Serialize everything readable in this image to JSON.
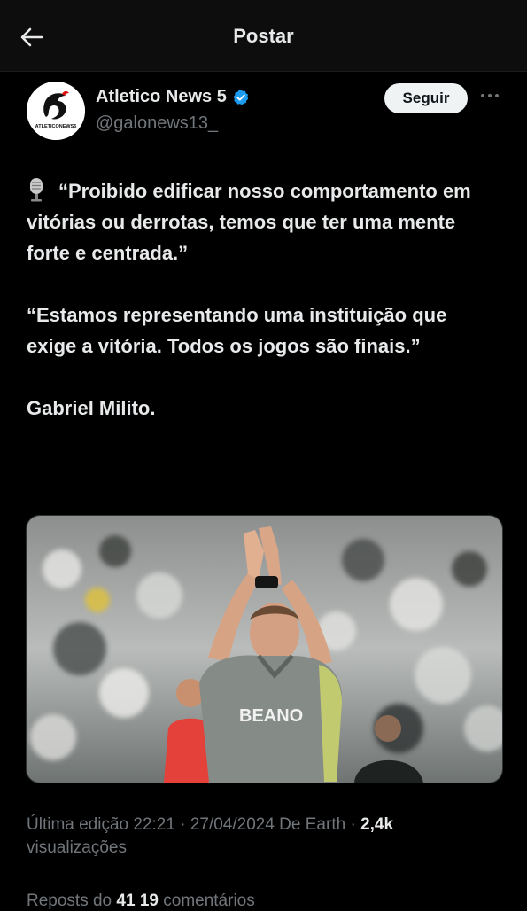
{
  "header": {
    "title": "Postar",
    "back_icon": "arrow-left-icon"
  },
  "author": {
    "name": "Atletico News 5",
    "handle": "@galonews13_",
    "verified": true,
    "verified_color": "#1d9bf0",
    "avatar_logo_text": "ATLETICONEWS5"
  },
  "actions": {
    "follow_label": "Seguir",
    "more_icon": "more-horizontal-icon"
  },
  "post": {
    "emoji_icon": "microphone-icon",
    "paragraph1": "“Proibido edificar nosso comportamento em vitórias ou derrotas, temos que ter uma mente forte e centrada.”",
    "paragraph2": "“Estamos representando uma instituição que exige a vitória. Todos os jogos são finais.”",
    "signature": "Gabriel Milito.",
    "image": {
      "description_shirt_text": "BEANO"
    }
  },
  "meta": {
    "edited": "Última edição 22:21 · 27/04/2024  De Earth · ",
    "views_count": "2,4k",
    "views_label": "visualizações"
  },
  "stats": {
    "reposts_label": "Reposts do",
    "reposts_count": "41",
    "comments_count": "19",
    "comments_label": "comentários"
  },
  "colors": {
    "background": "#000000",
    "text": "#e7e9ea",
    "secondary": "#71767b",
    "accent": "#1d9bf0"
  }
}
